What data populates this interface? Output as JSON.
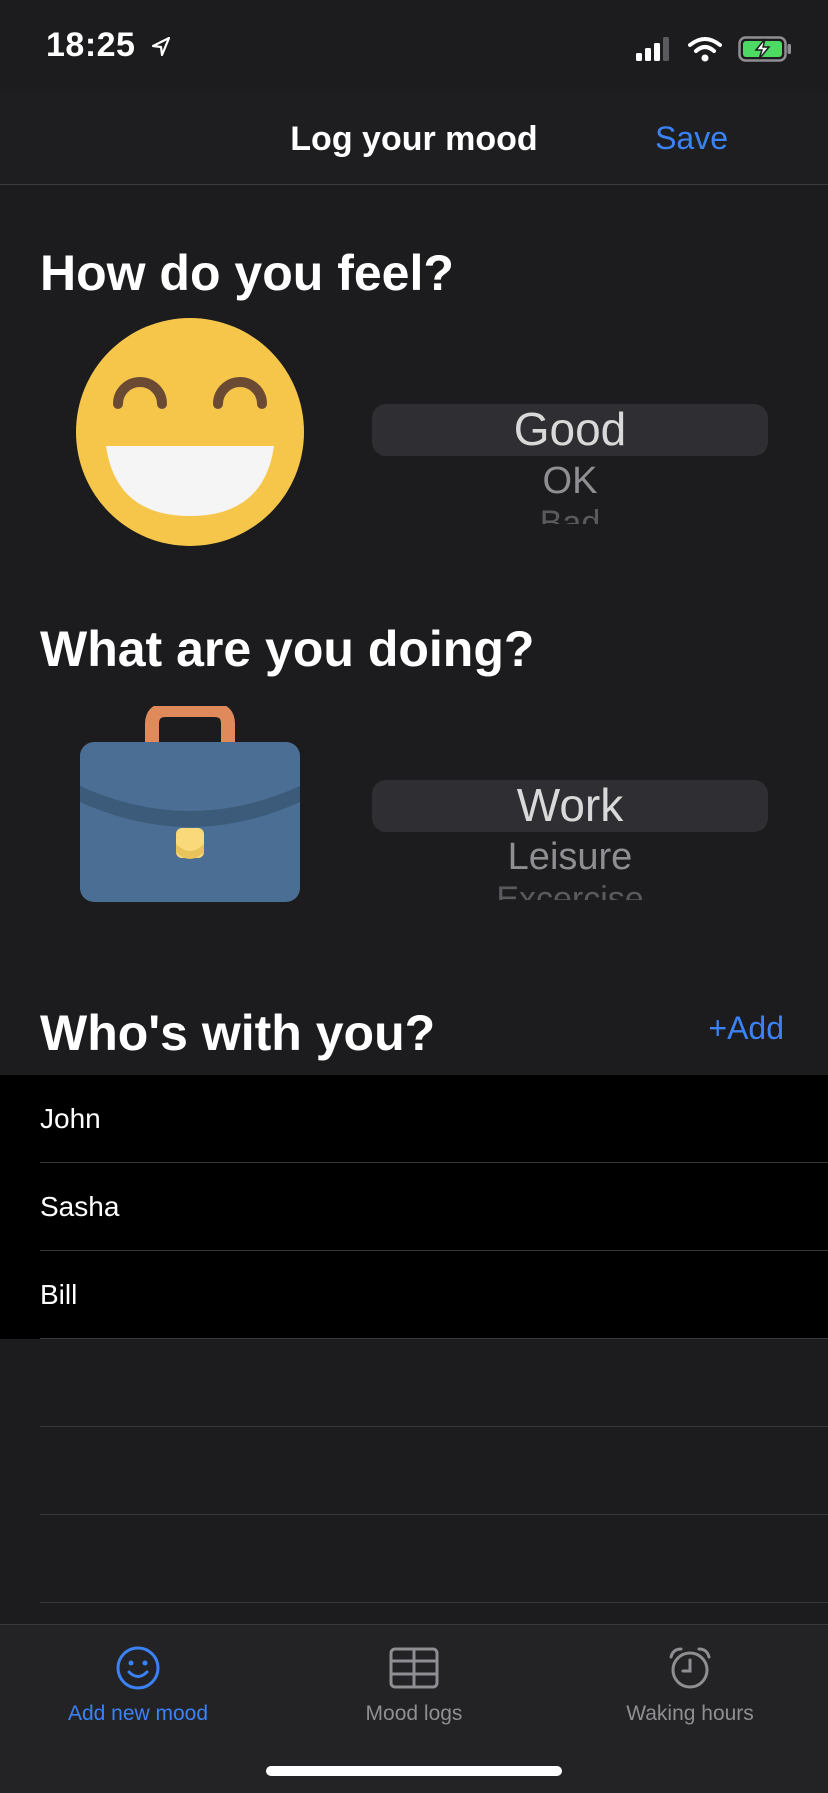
{
  "status_bar": {
    "time": "18:25"
  },
  "nav": {
    "title": "Log your mood",
    "save_label": "Save"
  },
  "feel_section": {
    "title": "How do you feel?",
    "icon": "grinning-face-icon",
    "options": [
      "Good",
      "OK",
      "Bad"
    ],
    "selected": "Good"
  },
  "doing_section": {
    "title": "What are you doing?",
    "icon": "briefcase-icon",
    "options": [
      "Work",
      "Leisure",
      "Excercise"
    ],
    "selected": "Work"
  },
  "with_section": {
    "title": "Who's with you?",
    "add_label": "+Add",
    "people": [
      "John",
      "Sasha",
      "Bill"
    ]
  },
  "tabbar": {
    "tabs": [
      {
        "label": "Add new mood",
        "icon": "smiley-icon",
        "active": true
      },
      {
        "label": "Mood logs",
        "icon": "table-icon",
        "active": false
      },
      {
        "label": "Waking hours",
        "icon": "alarm-clock-icon",
        "active": false
      }
    ]
  },
  "colors": {
    "accent": "#3b82f6",
    "background": "#1c1c1e",
    "list_bg": "#000000"
  }
}
